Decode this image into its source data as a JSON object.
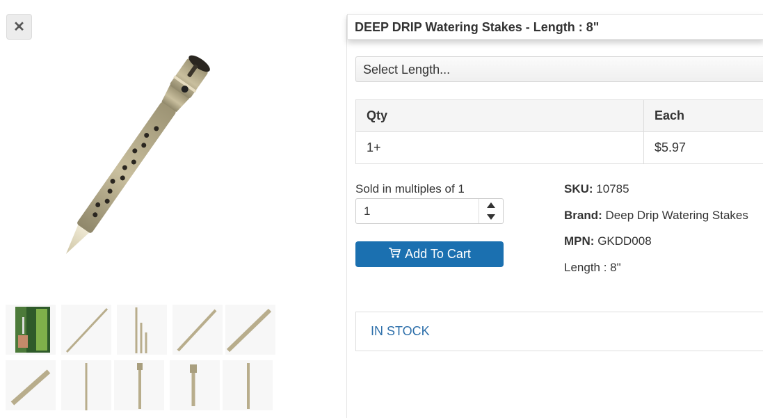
{
  "close": {
    "label": "✕"
  },
  "product": {
    "title": "DEEP DRIP Watering Stakes - Length : 8\"",
    "select_placeholder": "Select Length...",
    "price_table": {
      "headers": [
        "Qty",
        "Each"
      ],
      "rows": [
        [
          "1+",
          "$5.97"
        ]
      ]
    },
    "multiples_text": "Sold in multiples of 1",
    "quantity": "1",
    "add_to_cart_label": "Add To Cart",
    "sku_label": "SKU:",
    "sku_value": "10785",
    "brand_label": "Brand:",
    "brand_value": "Deep Drip Watering Stakes",
    "mpn_label": "MPN:",
    "mpn_value": "GKDD008",
    "length_text": "Length : 8\"",
    "stock_status": "IN STOCK"
  },
  "colors": {
    "accent": "#1b70b0",
    "stock": "#2d6faa",
    "stake": "#b8ad8c"
  },
  "icons": {
    "close": "close-icon",
    "cart": "cart-icon",
    "spin_up": "chevron-up-icon",
    "spin_down": "chevron-down-icon"
  }
}
